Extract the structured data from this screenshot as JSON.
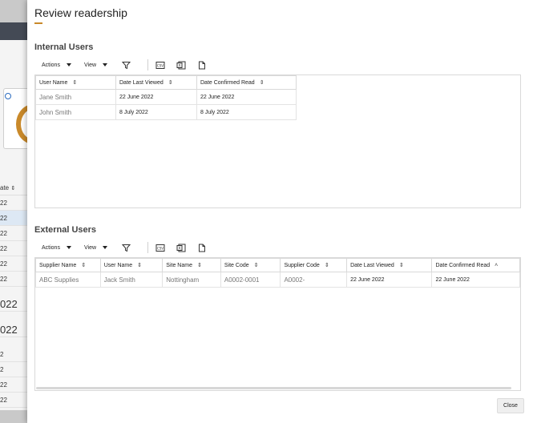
{
  "background": {
    "header_fragment": "ate",
    "rows": [
      "22",
      "22",
      "22",
      "22",
      "22",
      "22",
      "22",
      "022",
      "022",
      "2",
      "2",
      "22",
      "22",
      "2"
    ]
  },
  "dialog": {
    "title": "Review readership",
    "close_label": "Close"
  },
  "toolbar": {
    "actions_label": "Actions",
    "view_label": "View",
    "icons": [
      "filter-icon",
      "export-csv-icon",
      "export-excel-icon",
      "document-icon"
    ],
    "csv_glyph": "CSV",
    "excel_glyph": "X"
  },
  "internal": {
    "title": "Internal Users",
    "columns": [
      "User Name",
      "Date Last Viewed",
      "Date Confirmed Read"
    ],
    "rows": [
      [
        "Jane Smith",
        "22 June 2022",
        "22 June 2022"
      ],
      [
        "John Smith",
        "8 July 2022",
        "8 July 2022"
      ]
    ]
  },
  "external": {
    "title": "External Users",
    "columns": [
      "Supplier Name",
      "User Name",
      "Site Name",
      "Site Code",
      "Supplier Code",
      "Date Last Viewed",
      "Date Confirmed Read"
    ],
    "rows": [
      [
        "ABC Supplies",
        "Jack Smith",
        "Nottingham",
        "A0002-0001",
        "A0002-",
        "22 June 2022",
        "22 June 2022"
      ]
    ]
  },
  "colors": {
    "accent": "#c9892a",
    "border": "#d9d9d9",
    "selected_row_border": "#5a7fb0"
  }
}
